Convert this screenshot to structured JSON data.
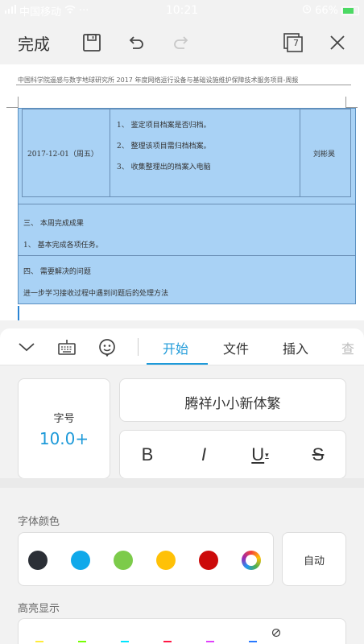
{
  "status_bar": {
    "carrier": "中国移动",
    "dots": "···",
    "time": "10:21",
    "battery": "66%"
  },
  "toolbar": {
    "done_label": "完成",
    "page_count": "7"
  },
  "document": {
    "header": "中国科学院遥感与数字地球研究所 2017 年度网络运行设备与基础设施维护保障技术服务项目-周报",
    "table": {
      "date": "2017-12-01（周五）",
      "tasks": [
        "1、 鉴定项目档案是否归档。",
        "2、 整理该项目需归档档案。",
        "3、 收集整理出的档案入电脑"
      ],
      "person": "刘彬昊"
    },
    "section3_title": "三、 本周完成成果",
    "section3_item": "1、 基本完成各项任务。",
    "section4_title": "四、 需要解决的问题",
    "section4_item": "进一步学习接收过程中遇到问题后的处理方法"
  },
  "panel": {
    "tabs": [
      "开始",
      "文件",
      "插入",
      "查"
    ],
    "font_size_label": "字号",
    "font_size_value": "10.0+",
    "font_name": "腾祥小小新体繁",
    "format_buttons": [
      "B",
      "I",
      "U",
      "S"
    ],
    "font_color_label": "字体颜色",
    "auto_label": "自动",
    "highlight_label": "高亮显示"
  },
  "colors": {
    "accent": "#1e9ad9",
    "swatches": [
      "#2b2f36",
      "#10a9ea",
      "#7ccb4a",
      "#ffc107",
      "#cc0a0a"
    ]
  }
}
